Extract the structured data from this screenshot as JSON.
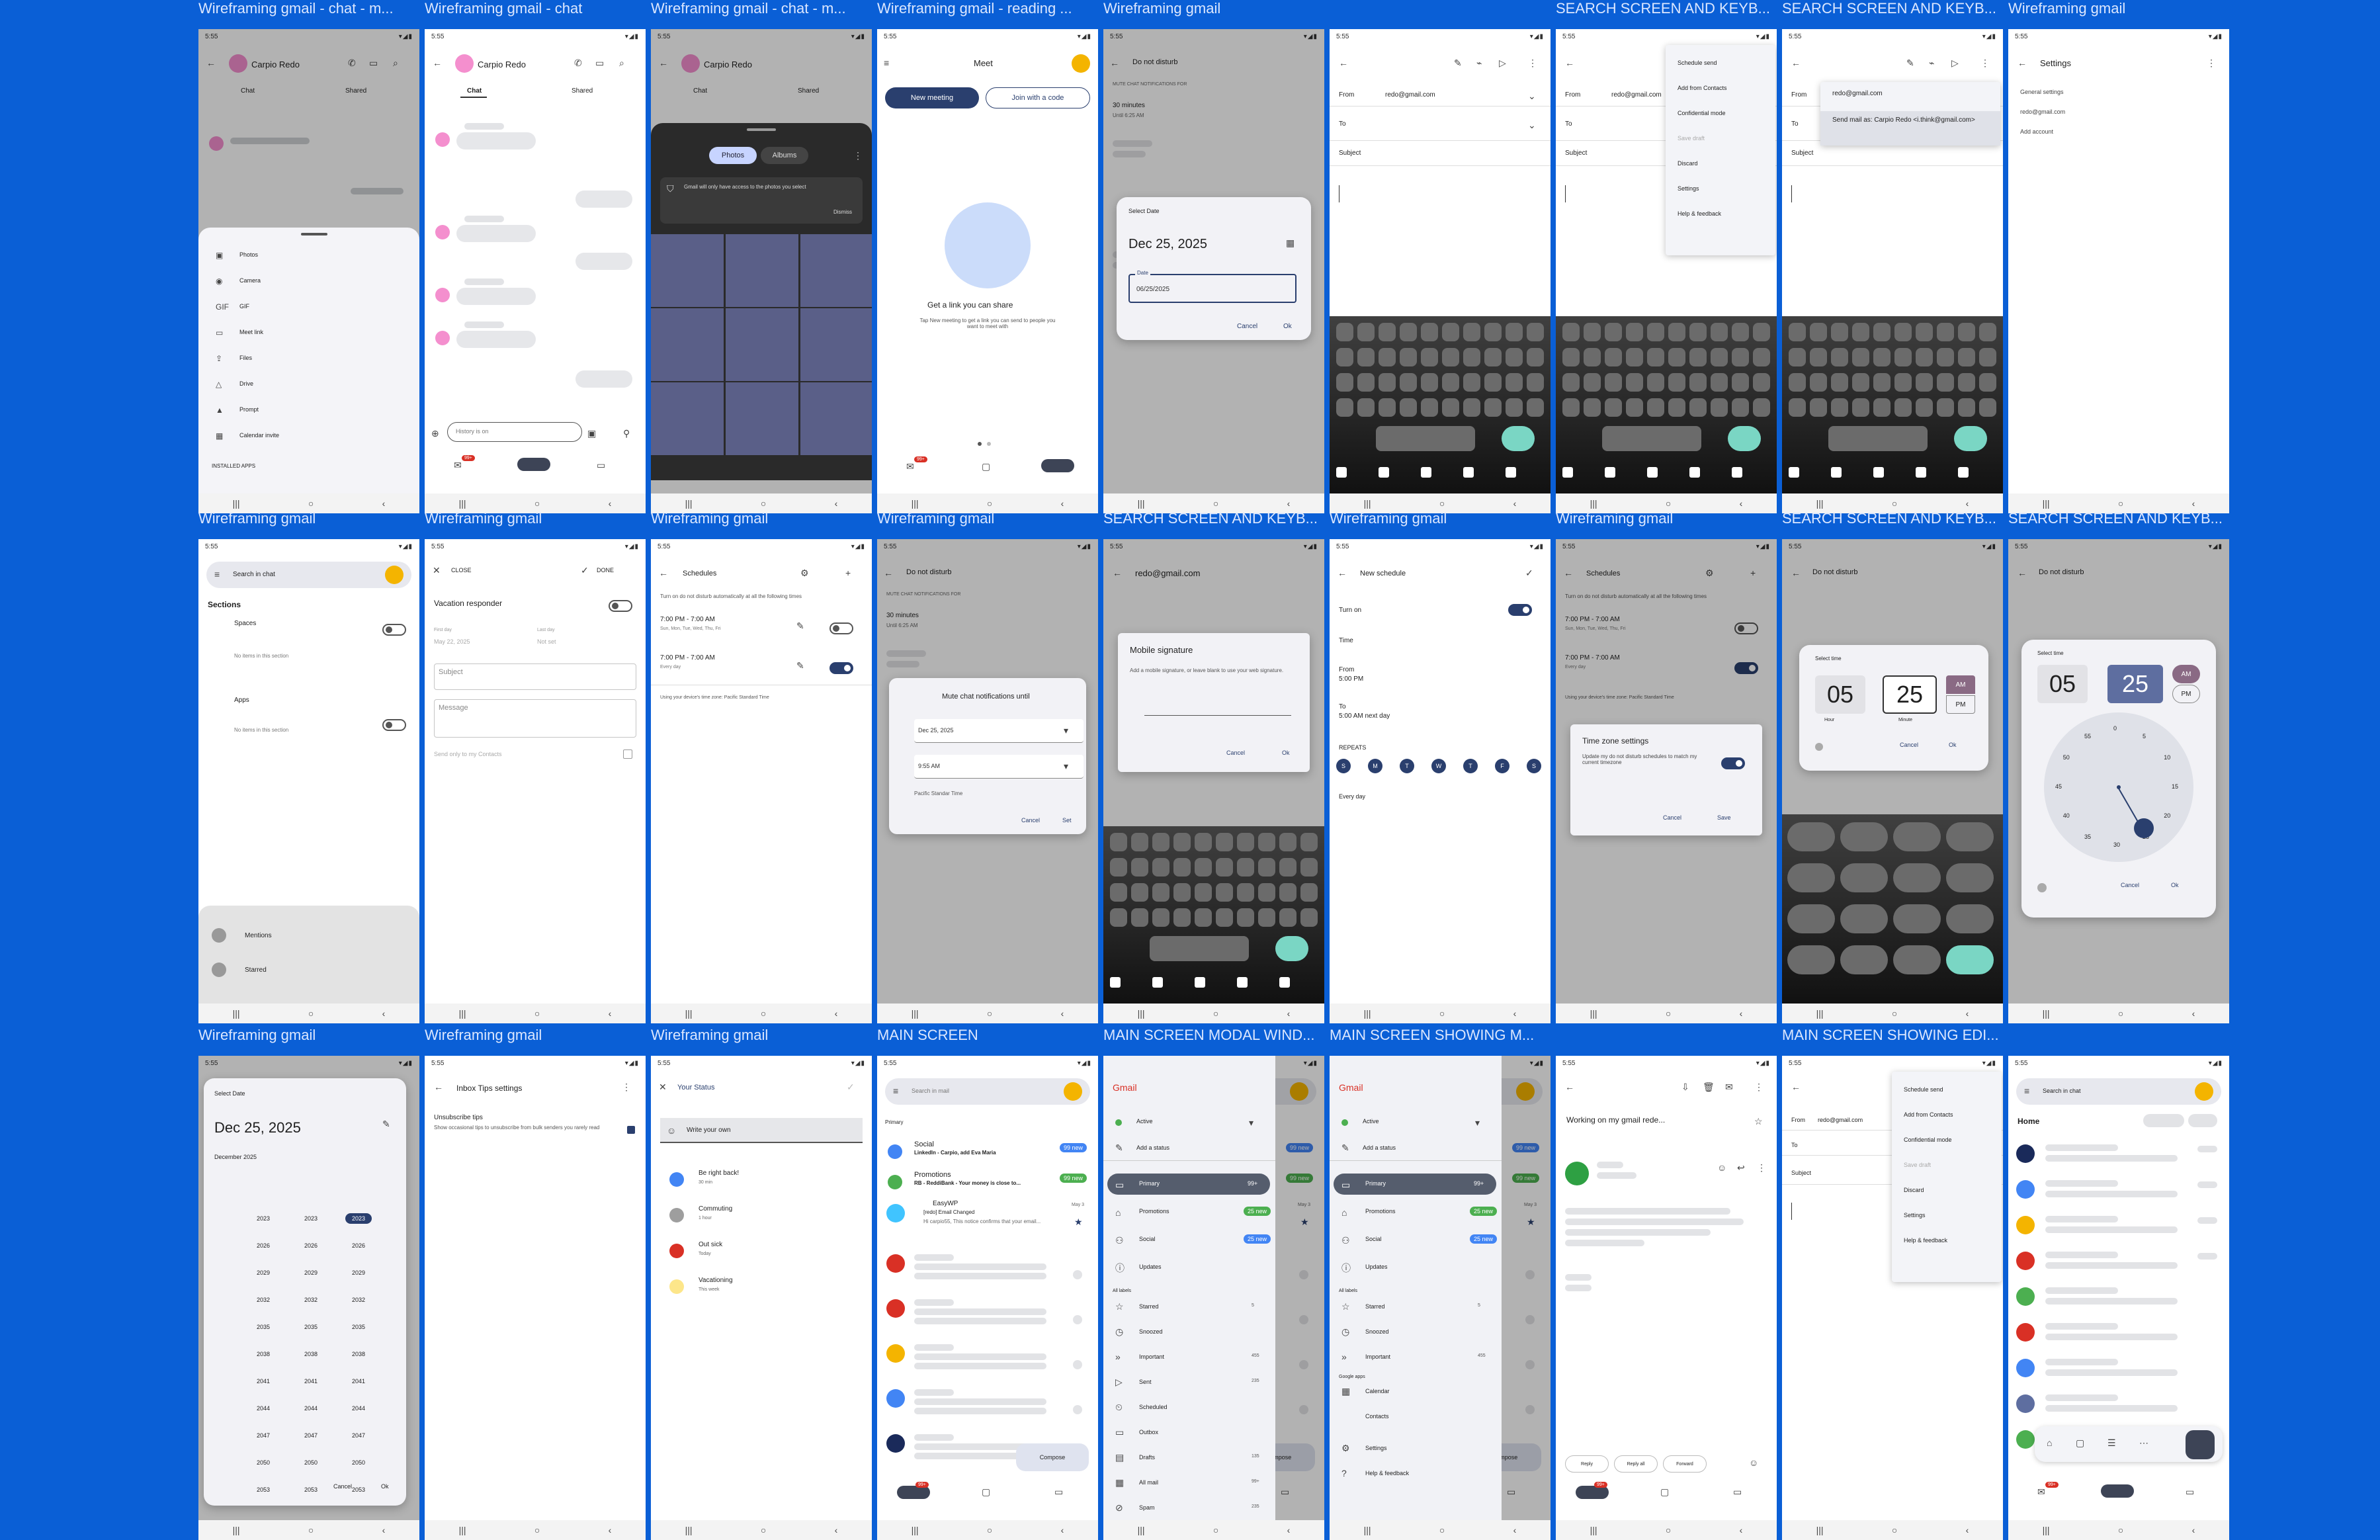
{
  "colors": {
    "background": "#0a5fd6",
    "accent": "#2a3f6e",
    "gmail_red": "#d93025",
    "yellow": "#f4b400",
    "green": "#4caf50",
    "blue": "#4285f4",
    "pink": "#f48fce",
    "teal": "#7ad6c4"
  },
  "titles": [
    "Wireframing gmail - chat - m...",
    "Wireframing gmail - chat",
    "Wireframing gmail - chat - m...",
    "Wireframing gmail - reading ...",
    "Wireframing gmail",
    "",
    "SEARCH SCREEN AND KEYB...",
    "SEARCH SCREEN AND KEYB...",
    "Wireframing gmail",
    "Wireframing gmail",
    "Wireframing gmail",
    "Wireframing gmail",
    "Wireframing gmail",
    "SEARCH SCREEN AND KEYB...",
    "Wireframing gmail",
    "Wireframing gmail",
    "SEARCH SCREEN AND KEYB...",
    "SEARCH SCREEN AND KEYB...",
    "Wireframing gmail",
    "Wireframing gmail",
    "Wireframing gmail",
    "MAIN SCREEN",
    "MAIN SCREEN MODAL WIND...",
    "MAIN SCREEN SHOWING M...",
    "",
    "MAIN SCREEN SHOWING EDI...",
    ""
  ],
  "status": {
    "time": "5:55",
    "icons": "▾◢▮"
  },
  "chat": {
    "contact": "Carpio Redo",
    "tab_chat": "Chat",
    "tab_shared": "Shared",
    "input_placeholder": "History is on"
  },
  "attach_sheet": {
    "items": [
      "Photos",
      "Camera",
      "GIF",
      "Meet link",
      "Files",
      "Drive",
      "Prompt",
      "Calendar invite"
    ],
    "footer": "INSTALLED APPS"
  },
  "photos_sheet": {
    "tab_photos": "Photos",
    "tab_albums": "Albums",
    "notice": "Gmail will only have access to the photos you select",
    "dismiss": "Dismiss"
  },
  "meet": {
    "title": "Meet",
    "new_meeting": "New meeting",
    "join": "Join with a code",
    "heading": "Get a link you can share",
    "body": "Tap New meeting to get a link you can send to people you want to meet with",
    "badge": "99+"
  },
  "dnd": {
    "title": "Do not disturb",
    "subtitle": "MUTE CHAT NOTIFICATIONS FOR",
    "opt1": "30 minutes",
    "opt1_sub": "Until 6:25 AM"
  },
  "select_date": {
    "label": "Select Date",
    "date": "Dec 25, 2025",
    "field_label": "Date",
    "field_value": "06/25/2025",
    "cancel": "Cancel",
    "ok": "Ok"
  },
  "compose": {
    "from_label": "From",
    "from_value": "redo@gmail.com",
    "to_label": "To",
    "subject_label": "Subject",
    "send_as": "Send mail as: Carpio Redo <i.think@gmail.com>"
  },
  "compose_menu": [
    "Schedule send",
    "Add from Contacts",
    "Confidential mode",
    "Save draft",
    "Discard",
    "Settings",
    "Help & feedback"
  ],
  "settings": {
    "title": "Settings",
    "items": [
      "General settings",
      "redo@gmail.com",
      "Add account"
    ]
  },
  "search_chat": {
    "placeholder": "Search in chat",
    "sections": "Sections",
    "spaces": "Spaces",
    "apps": "Apps",
    "no_items": "No items in this section",
    "mentions": "Mentions",
    "starred": "Starred"
  },
  "vacation": {
    "close": "CLOSE",
    "done": "DONE",
    "title": "Vacation responder",
    "first_day": "First day",
    "first_day_val": "May 22, 2025",
    "last_day": "Last day",
    "last_day_val": "Not set",
    "subject": "Subject",
    "message": "Message",
    "contacts_only": "Send only to my Contacts"
  },
  "schedules": {
    "title": "Schedules",
    "intro": "Turn on do not disturb automatically at all the following times",
    "s1": "7:00 PM - 7:00 AM",
    "s1_days": "Sun, Mon, Tue, Wed, Thu, Fri",
    "s2": "7:00 PM - 7:00 AM",
    "s2_days": "Every day",
    "tz": "Using your device's time zone: Pacific Standard Time"
  },
  "mute_until": {
    "title": "Mute chat notifications until",
    "date": "Dec 25, 2025",
    "time": "9:55 AM",
    "tz": "Pacific Standar Time",
    "cancel": "Cancel",
    "set": "Set"
  },
  "signature": {
    "header": "redo@gmail.com",
    "title": "Mobile signature",
    "body": "Add a mobile signature, or leave blank to use your web signature.",
    "cancel": "Cancel",
    "ok": "Ok"
  },
  "new_schedule": {
    "title": "New schedule",
    "turn_on": "Turn on",
    "time": "Time",
    "from": "From",
    "from_val": "5:00 PM",
    "to": "To",
    "to_val": "5:00 AM next day",
    "repeats": "REPEATS",
    "days": [
      "S",
      "M",
      "T",
      "W",
      "T",
      "F",
      "S"
    ],
    "every_day": "Every day"
  },
  "tz_settings": {
    "title": "Time zone settings",
    "body": "Update my do not disturb schedules to match my current timezone",
    "cancel": "Cancel",
    "save": "Save",
    "footer": "Using your device's time zone: Pacific Standard Time"
  },
  "time_picker": {
    "label": "Select time",
    "hour": "05",
    "minute": "25",
    "am": "AM",
    "pm": "PM",
    "hour_label": "Hour",
    "minute_label": "Minute",
    "cancel": "Cancel",
    "ok": "Ok",
    "dial": [
      "55",
      "0",
      "5",
      "10",
      "15",
      "20",
      "25",
      "30",
      "35",
      "40",
      "45",
      "50"
    ]
  },
  "year_picker": {
    "label": "Select Date",
    "date": "Dec 25, 2025",
    "month": "December 2025",
    "years": [
      "2023",
      "2023",
      "2023",
      "2026",
      "2026",
      "2026",
      "2029",
      "2029",
      "2029",
      "2032",
      "2032",
      "2032",
      "2035",
      "2035",
      "2035",
      "2038",
      "2038",
      "2038",
      "2041",
      "2041",
      "2041",
      "2044",
      "2044",
      "2044",
      "2047",
      "2047",
      "2047",
      "2050",
      "2050",
      "2050",
      "2053",
      "2053",
      "2053"
    ],
    "cancel": "Cancel",
    "ok": "Ok"
  },
  "inbox_tips": {
    "title": "Inbox Tips settings",
    "heading": "Unsubscribe tips",
    "body": "Show occasional tips to unsubscribe from bulk senders you rarely read"
  },
  "status_screen": {
    "title": "Your Status",
    "write": "Write your own",
    "items": [
      {
        "name": "Be right back!",
        "sub": "30 min"
      },
      {
        "name": "Commuting",
        "sub": "1 hour"
      },
      {
        "name": "Out sick",
        "sub": "Today"
      },
      {
        "name": "Vacationing",
        "sub": "This week"
      }
    ]
  },
  "main": {
    "search": "Search in mail",
    "primary": "Primary",
    "r1_title": "Social",
    "r1_sub": "LinkedIn - Carpio, add Eva Maria",
    "r1_chip": "99 new",
    "r2_title": "Promotions",
    "r2_sub": "RB - ReddiBank - Your money is close to...",
    "r2_chip": "99 new",
    "r3_title": "EasyWP",
    "r3_sub": "[redo] Email Changed",
    "r3_body": "Hi carpio55, This notice confirms that your email...",
    "r3_date": "May 3",
    "compose": "Compose"
  },
  "drawer": {
    "brand": "Gmail",
    "active": "Active",
    "add_status": "Add a status",
    "items": [
      {
        "l": "Primary",
        "c": "99+"
      },
      {
        "l": "Promotions",
        "c": "25 new"
      },
      {
        "l": "Social",
        "c": "25 new"
      },
      {
        "l": "Updates",
        "c": ""
      }
    ],
    "all_labels": "All labels",
    "labels": [
      {
        "l": "Starred",
        "c": "5"
      },
      {
        "l": "Snoozed",
        "c": ""
      },
      {
        "l": "Important",
        "c": "455"
      },
      {
        "l": "Sent",
        "c": "235"
      },
      {
        "l": "Scheduled",
        "c": ""
      },
      {
        "l": "Outbox",
        "c": ""
      },
      {
        "l": "Drafts",
        "c": "135"
      },
      {
        "l": "All mail",
        "c": "99+"
      },
      {
        "l": "Spam",
        "c": "235"
      }
    ],
    "google_apps": "Google apps",
    "calendar": "Calendar",
    "contacts": "Contacts",
    "settings": "Settings",
    "help": "Help & feedback"
  },
  "reading": {
    "subject": "Working on my gmail rede...",
    "reply": "Reply",
    "reply_all": "Reply all",
    "forward": "Forward"
  },
  "home_chat": {
    "search": "Search in chat",
    "home": "Home"
  }
}
